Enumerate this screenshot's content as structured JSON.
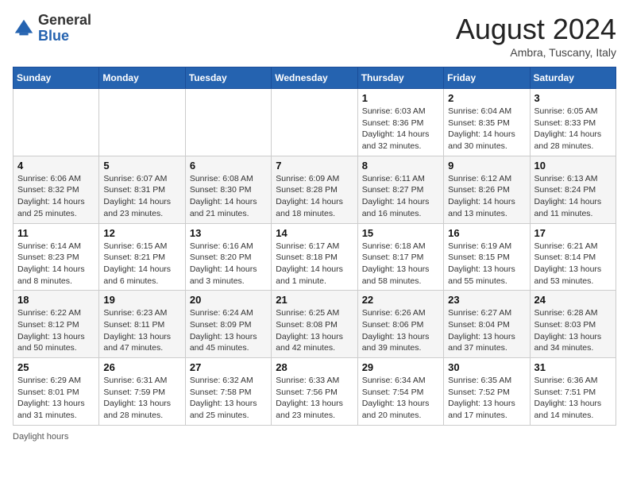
{
  "header": {
    "logo_general": "General",
    "logo_blue": "Blue",
    "month_title": "August 2024",
    "location": "Ambra, Tuscany, Italy"
  },
  "weekdays": [
    "Sunday",
    "Monday",
    "Tuesday",
    "Wednesday",
    "Thursday",
    "Friday",
    "Saturday"
  ],
  "weeks": [
    [
      {
        "day": "",
        "info": ""
      },
      {
        "day": "",
        "info": ""
      },
      {
        "day": "",
        "info": ""
      },
      {
        "day": "",
        "info": ""
      },
      {
        "day": "1",
        "info": "Sunrise: 6:03 AM\nSunset: 8:36 PM\nDaylight: 14 hours\nand 32 minutes."
      },
      {
        "day": "2",
        "info": "Sunrise: 6:04 AM\nSunset: 8:35 PM\nDaylight: 14 hours\nand 30 minutes."
      },
      {
        "day": "3",
        "info": "Sunrise: 6:05 AM\nSunset: 8:33 PM\nDaylight: 14 hours\nand 28 minutes."
      }
    ],
    [
      {
        "day": "4",
        "info": "Sunrise: 6:06 AM\nSunset: 8:32 PM\nDaylight: 14 hours\nand 25 minutes."
      },
      {
        "day": "5",
        "info": "Sunrise: 6:07 AM\nSunset: 8:31 PM\nDaylight: 14 hours\nand 23 minutes."
      },
      {
        "day": "6",
        "info": "Sunrise: 6:08 AM\nSunset: 8:30 PM\nDaylight: 14 hours\nand 21 minutes."
      },
      {
        "day": "7",
        "info": "Sunrise: 6:09 AM\nSunset: 8:28 PM\nDaylight: 14 hours\nand 18 minutes."
      },
      {
        "day": "8",
        "info": "Sunrise: 6:11 AM\nSunset: 8:27 PM\nDaylight: 14 hours\nand 16 minutes."
      },
      {
        "day": "9",
        "info": "Sunrise: 6:12 AM\nSunset: 8:26 PM\nDaylight: 14 hours\nand 13 minutes."
      },
      {
        "day": "10",
        "info": "Sunrise: 6:13 AM\nSunset: 8:24 PM\nDaylight: 14 hours\nand 11 minutes."
      }
    ],
    [
      {
        "day": "11",
        "info": "Sunrise: 6:14 AM\nSunset: 8:23 PM\nDaylight: 14 hours\nand 8 minutes."
      },
      {
        "day": "12",
        "info": "Sunrise: 6:15 AM\nSunset: 8:21 PM\nDaylight: 14 hours\nand 6 minutes."
      },
      {
        "day": "13",
        "info": "Sunrise: 6:16 AM\nSunset: 8:20 PM\nDaylight: 14 hours\nand 3 minutes."
      },
      {
        "day": "14",
        "info": "Sunrise: 6:17 AM\nSunset: 8:18 PM\nDaylight: 14 hours\nand 1 minute."
      },
      {
        "day": "15",
        "info": "Sunrise: 6:18 AM\nSunset: 8:17 PM\nDaylight: 13 hours\nand 58 minutes."
      },
      {
        "day": "16",
        "info": "Sunrise: 6:19 AM\nSunset: 8:15 PM\nDaylight: 13 hours\nand 55 minutes."
      },
      {
        "day": "17",
        "info": "Sunrise: 6:21 AM\nSunset: 8:14 PM\nDaylight: 13 hours\nand 53 minutes."
      }
    ],
    [
      {
        "day": "18",
        "info": "Sunrise: 6:22 AM\nSunset: 8:12 PM\nDaylight: 13 hours\nand 50 minutes."
      },
      {
        "day": "19",
        "info": "Sunrise: 6:23 AM\nSunset: 8:11 PM\nDaylight: 13 hours\nand 47 minutes."
      },
      {
        "day": "20",
        "info": "Sunrise: 6:24 AM\nSunset: 8:09 PM\nDaylight: 13 hours\nand 45 minutes."
      },
      {
        "day": "21",
        "info": "Sunrise: 6:25 AM\nSunset: 8:08 PM\nDaylight: 13 hours\nand 42 minutes."
      },
      {
        "day": "22",
        "info": "Sunrise: 6:26 AM\nSunset: 8:06 PM\nDaylight: 13 hours\nand 39 minutes."
      },
      {
        "day": "23",
        "info": "Sunrise: 6:27 AM\nSunset: 8:04 PM\nDaylight: 13 hours\nand 37 minutes."
      },
      {
        "day": "24",
        "info": "Sunrise: 6:28 AM\nSunset: 8:03 PM\nDaylight: 13 hours\nand 34 minutes."
      }
    ],
    [
      {
        "day": "25",
        "info": "Sunrise: 6:29 AM\nSunset: 8:01 PM\nDaylight: 13 hours\nand 31 minutes."
      },
      {
        "day": "26",
        "info": "Sunrise: 6:31 AM\nSunset: 7:59 PM\nDaylight: 13 hours\nand 28 minutes."
      },
      {
        "day": "27",
        "info": "Sunrise: 6:32 AM\nSunset: 7:58 PM\nDaylight: 13 hours\nand 25 minutes."
      },
      {
        "day": "28",
        "info": "Sunrise: 6:33 AM\nSunset: 7:56 PM\nDaylight: 13 hours\nand 23 minutes."
      },
      {
        "day": "29",
        "info": "Sunrise: 6:34 AM\nSunset: 7:54 PM\nDaylight: 13 hours\nand 20 minutes."
      },
      {
        "day": "30",
        "info": "Sunrise: 6:35 AM\nSunset: 7:52 PM\nDaylight: 13 hours\nand 17 minutes."
      },
      {
        "day": "31",
        "info": "Sunrise: 6:36 AM\nSunset: 7:51 PM\nDaylight: 13 hours\nand 14 minutes."
      }
    ]
  ],
  "footer": {
    "daylight_label": "Daylight hours"
  }
}
